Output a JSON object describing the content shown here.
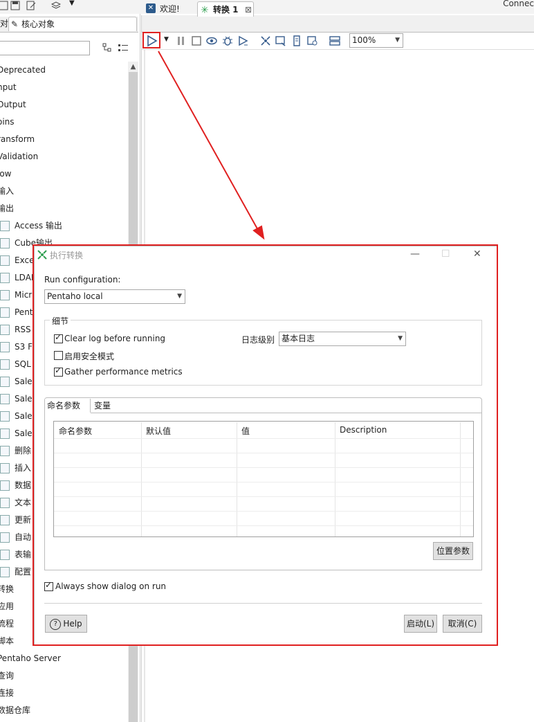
{
  "topbar": {
    "connect": "Connec"
  },
  "left": {
    "tabs": {
      "first_partial": "对",
      "core": "核心对象"
    },
    "tree": [
      {
        "label": "Deprecated",
        "indent": -4
      },
      {
        "label": "nput",
        "indent": -4
      },
      {
        "label": "Output",
        "indent": -4
      },
      {
        "label": "oins",
        "indent": -4
      },
      {
        "label": "ransform",
        "indent": -4
      },
      {
        "label": "Validation",
        "indent": -4
      },
      {
        "label": "low",
        "indent": -4
      },
      {
        "label": "输入",
        "indent": -4
      },
      {
        "label": "输出",
        "indent": -4
      },
      {
        "label": "Access 输出",
        "sub": true
      },
      {
        "label": "Cube输出",
        "sub": true
      },
      {
        "label": "Exce",
        "sub": true
      },
      {
        "label": "LDAP",
        "sub": true
      },
      {
        "label": "Micr",
        "sub": true
      },
      {
        "label": "Pent",
        "sub": true
      },
      {
        "label": "RSS",
        "sub": true
      },
      {
        "label": "S3 Fi",
        "sub": true
      },
      {
        "label": "SQL",
        "sub": true
      },
      {
        "label": "Sales",
        "sub": true
      },
      {
        "label": "Sales",
        "sub": true
      },
      {
        "label": "Sales",
        "sub": true
      },
      {
        "label": "Sales",
        "sub": true
      },
      {
        "label": "删除",
        "sub": true
      },
      {
        "label": "插入",
        "sub": true
      },
      {
        "label": "数据",
        "sub": true
      },
      {
        "label": "文本",
        "sub": true
      },
      {
        "label": "更新",
        "sub": true
      },
      {
        "label": "自动",
        "sub": true
      },
      {
        "label": "表输",
        "sub": true
      },
      {
        "label": "配置",
        "sub": true
      },
      {
        "label": "转换",
        "indent": -4
      },
      {
        "label": "应用",
        "indent": -4
      },
      {
        "label": "流程",
        "indent": -4
      },
      {
        "label": "脚本",
        "indent": -4
      },
      {
        "label": "Pentaho Server",
        "indent": -4
      },
      {
        "label": "查询",
        "indent": -4
      },
      {
        "label": "连接",
        "indent": -4
      },
      {
        "label": "数据仓库",
        "indent": -4
      }
    ]
  },
  "editor": {
    "tabs": {
      "welcome": "欢迎!",
      "transform": "转换 1",
      "close": "⊠"
    },
    "zoom": "100%"
  },
  "dialog": {
    "title": "执行转换",
    "run_config_label": "Run configuration:",
    "run_config_value": "Pentaho local",
    "details_legend": "细节",
    "clear_log": "Clear log before running",
    "safe_mode": "启用安全模式",
    "gather_metrics": "Gather performance metrics",
    "log_level_label": "日志级别",
    "log_level_value": "基本日志",
    "tabs": {
      "named_params": "命名参数",
      "variables": "变量"
    },
    "columns": [
      "命名参数",
      "默认值",
      "值",
      "Description"
    ],
    "pos_params_button": "位置参数",
    "always_show": "Always show dialog on run",
    "help_button": "Help",
    "start_button": "启动(L)",
    "cancel_button": "取消(C)",
    "checks": {
      "clear_log": true,
      "safe_mode": false,
      "gather_metrics": true,
      "always_show": true
    }
  },
  "colors": {
    "highlight": "#e02020",
    "accent_green": "#2e9e4f",
    "icon_blue": "#3a5f8f"
  }
}
